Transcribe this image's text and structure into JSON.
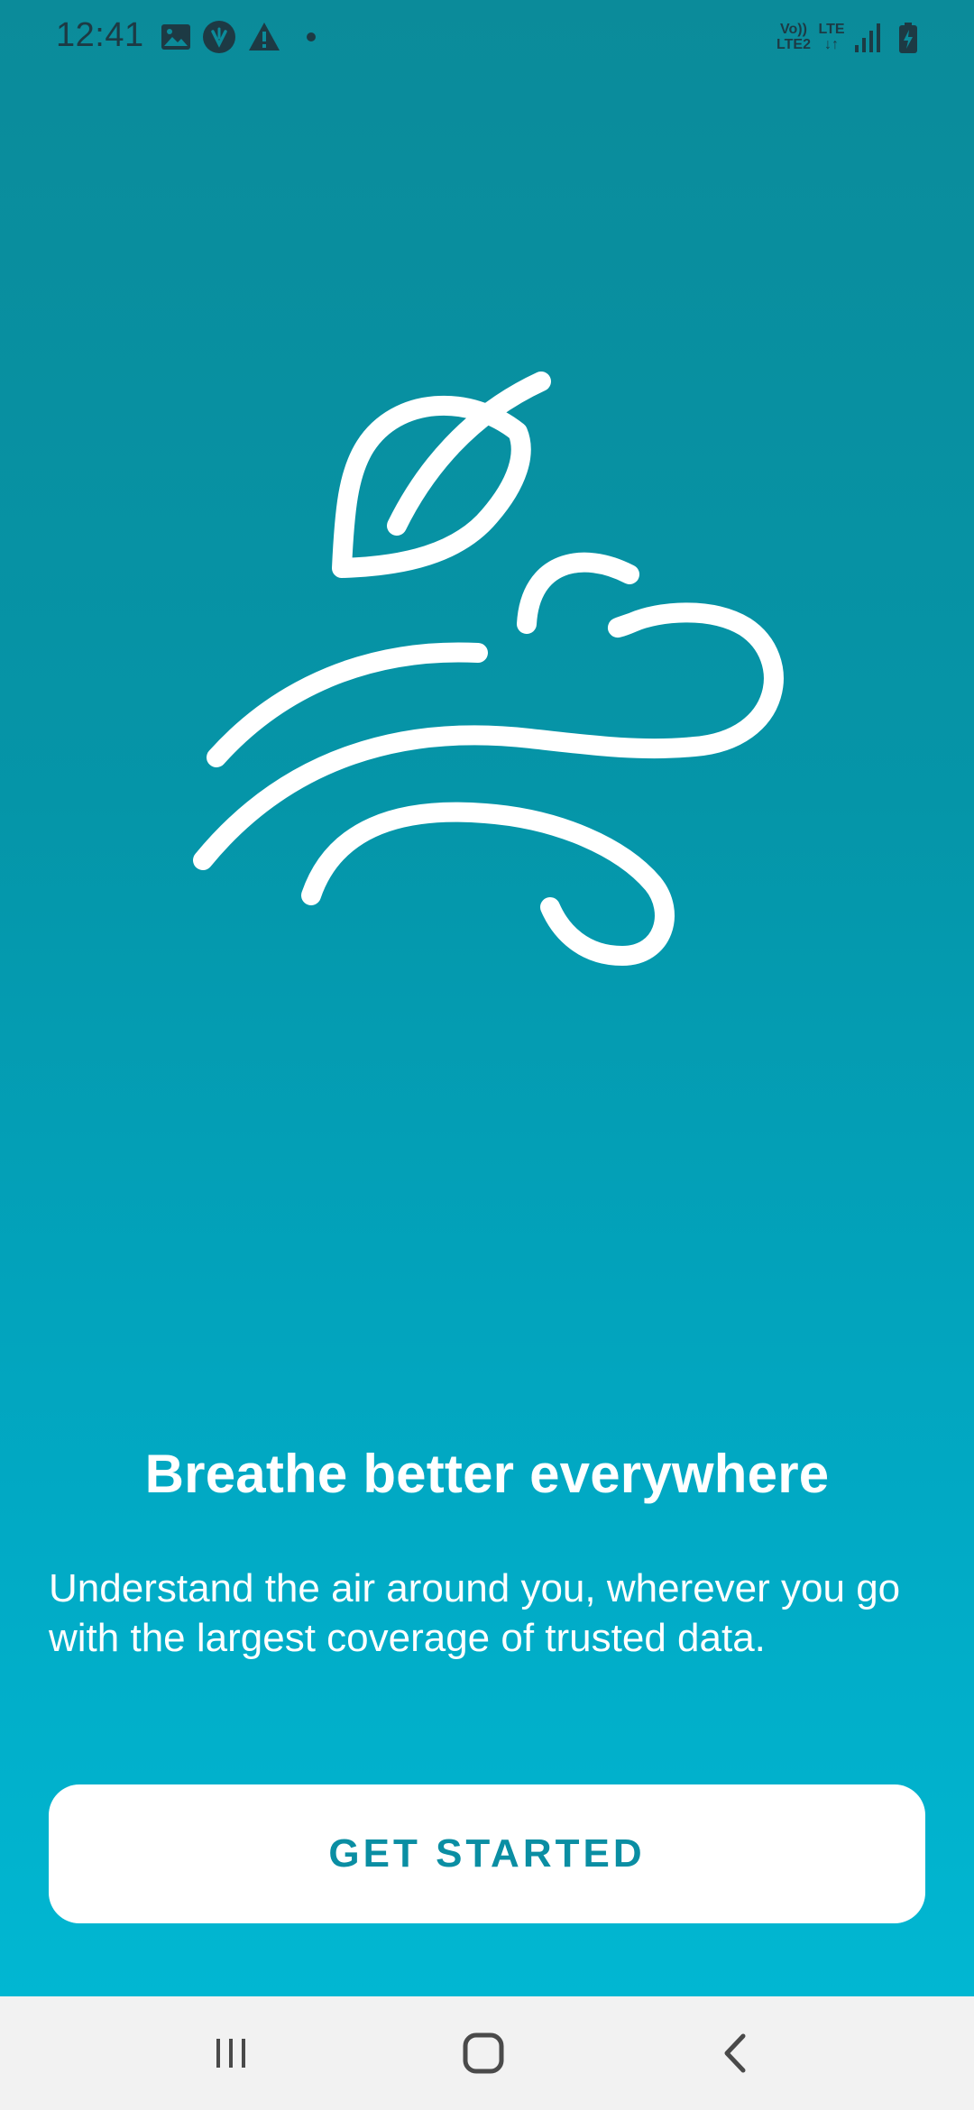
{
  "status_bar": {
    "time": "12:41",
    "icons": [
      "gallery-icon",
      "vpn-icon",
      "warning-icon",
      "dot-icon"
    ],
    "network_label_top": "Vo))",
    "network_label_bottom": "LTE2",
    "lte_label": "LTE",
    "right_icons": [
      "volte-icon",
      "lte-data-icon",
      "signal-icon",
      "battery-charging-icon"
    ]
  },
  "illustration": {
    "icon": "leaf-wind-icon"
  },
  "onboarding": {
    "title": "Breathe better everywhere",
    "description": "Understand the air around you, wherever you go with the largest coverage of trusted data."
  },
  "cta": {
    "label": "GET STARTED"
  },
  "nav_bar": {
    "buttons": [
      "recent-apps-icon",
      "home-icon",
      "back-icon"
    ]
  },
  "colors": {
    "gradient_top": "#0b8b9a",
    "gradient_bottom": "#01b7d2",
    "button_text": "#0a8ea3",
    "nav_background": "#f2f2f2"
  }
}
